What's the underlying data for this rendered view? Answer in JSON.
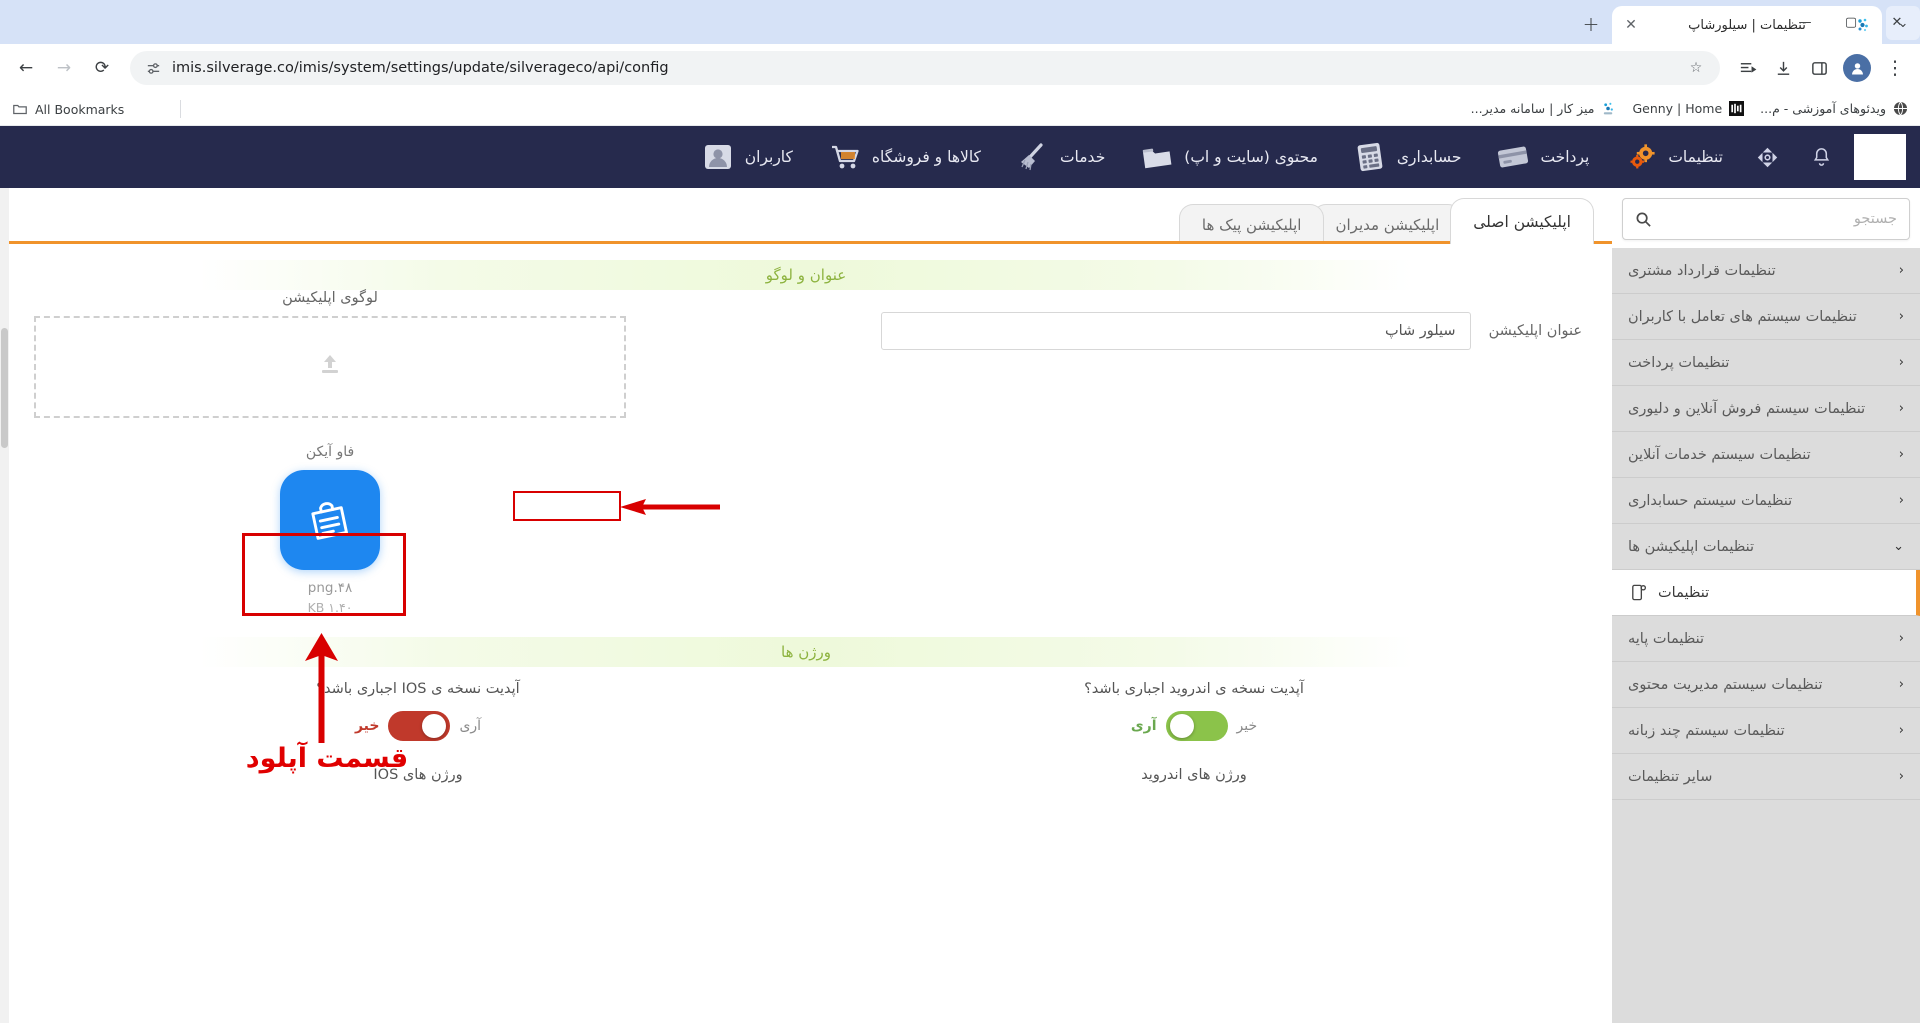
{
  "browser": {
    "tab": {
      "title": "تنظیمات | سیلورشاپ",
      "favicon": "silverage-icon",
      "close": "✕"
    },
    "new_tab_label": "+",
    "tab_list_chevron": "⌄",
    "window_controls": {
      "minimize": "—",
      "maximize": "▢",
      "close": "✕"
    },
    "nav": {
      "back": "←",
      "forward": "→",
      "reload": "⟳"
    },
    "omnibox": {
      "url": "imis.silverage.co/imis/system/settings/update/silverageco/api/config",
      "site_info_icon": "site-settings-icon",
      "star_icon": "☆"
    },
    "toolbar_icons": {
      "reading_list": "reading-list-icon",
      "downloads": "download-icon",
      "side_panel": "side-panel-icon",
      "profile": "profile-avatar-icon",
      "menu": "⋮"
    },
    "bookmarks": [
      {
        "label": "ویدئوهای آموزشی - م...",
        "icon": "globe-icon"
      },
      {
        "label": "Genny | Home",
        "icon": "genny-icon"
      },
      {
        "label": "میز کار | سامانه مدیر...",
        "icon": "silverage-icon"
      }
    ],
    "all_bookmarks": {
      "label": "All Bookmarks",
      "icon": "folder-icon"
    }
  },
  "appnav": {
    "items": [
      {
        "label": "تنظیمات",
        "icon": "gears-icon"
      },
      {
        "label": "پرداخت",
        "icon": "credit-card-icon"
      },
      {
        "label": "حسابداری",
        "icon": "calculator-icon"
      },
      {
        "label": "محتوی (سایت و اپ)",
        "icon": "folder-icon"
      },
      {
        "label": "خدمات",
        "icon": "broom-icon"
      },
      {
        "label": "کالاها و فروشگاه",
        "icon": "cart-icon"
      },
      {
        "label": "کاربران",
        "icon": "user-icon"
      }
    ],
    "left_icons": [
      {
        "name": "brand-logo-box"
      },
      {
        "name": "bell-icon",
        "glyph": "🔔"
      },
      {
        "name": "move-icon",
        "glyph": "✥"
      }
    ]
  },
  "sidebar": {
    "search": {
      "placeholder": "جستجو",
      "value": "",
      "icon": "search-icon"
    },
    "items": [
      {
        "label": "تنظیمات قرارداد مشتری",
        "chevron": "‹",
        "active": false
      },
      {
        "label": "تنظیمات سیستم های تعامل با کاربران",
        "chevron": "‹",
        "active": false
      },
      {
        "label": "تنظیمات پرداخت",
        "chevron": "‹",
        "active": false
      },
      {
        "label": "تنظیمات سیستم فروش آنلاین و دلیوری",
        "chevron": "‹",
        "active": false
      },
      {
        "label": "تنظیمات سیستم خدمات آنلاین",
        "chevron": "‹",
        "active": false
      },
      {
        "label": "تنظیمات سیستم حسابداری",
        "chevron": "‹",
        "active": false
      },
      {
        "label": "تنظیمات اپلیکیشن ها",
        "chevron": "⌄",
        "active": false
      },
      {
        "label": "تنظیمات",
        "chevron": "",
        "active": true,
        "icon": "app-settings-icon"
      },
      {
        "label": "تنظیمات پایه",
        "chevron": "‹",
        "active": false
      },
      {
        "label": "تنظیمات سیستم مدیریت محتوی",
        "chevron": "‹",
        "active": false
      },
      {
        "label": "تنظیمات سیستم چند زبانه",
        "chevron": "‹",
        "active": false
      },
      {
        "label": "سایر تنظیمات",
        "chevron": "‹",
        "active": false
      }
    ]
  },
  "content": {
    "tabs": [
      {
        "label": "اپلیکیشن پیک ها",
        "selected": false
      },
      {
        "label": "اپلیکیشن مدیران",
        "selected": false
      },
      {
        "label": "اپلیکیشن اصلی",
        "selected": true
      }
    ],
    "section_title": "عنوان و لوگو",
    "app_title_label": "عنوان اپلیکیشن",
    "app_title_value": "سیلور شاپ",
    "logo_label": "لوگوی اپلیکیشن",
    "upload_icon": "upload-icon",
    "favicon": {
      "label": "فاو آیکن",
      "file_name": "png.۴۸",
      "file_size": "KB ۱.۴۰",
      "image": "shopping-bag-app-icon"
    },
    "versions_title": "ورژن ها",
    "ios": {
      "question": "آپدیت نسخه ی IOS اجباری باشد؟",
      "label_on": "آری",
      "label_off": "خیر",
      "state": "off",
      "versions_label": "ورژن های IOS"
    },
    "android": {
      "question": "آپدیت نسخه ی اندروید اجباری باشد؟",
      "label_on": "آری",
      "label_off": "خیر",
      "state": "on",
      "versions_label": "ورژن های اندروید"
    }
  },
  "annotations": {
    "upload_note": "قسمت آپلود",
    "color": "#d80000"
  }
}
